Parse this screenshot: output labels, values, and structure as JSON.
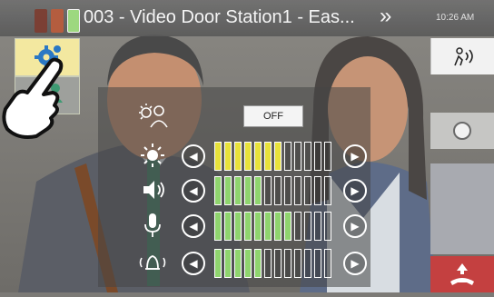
{
  "header": {
    "title": "003 - Video Door Station1 - Eas...",
    "time": "10:26 AM",
    "next_icon": "double-chevron-right-icon",
    "signal_colors": [
      "#7a3a2e",
      "#b85a3a",
      "#9fe07f"
    ]
  },
  "left_buttons": [
    {
      "icon": "gear-icon",
      "active": true
    },
    {
      "icon": "person-adjust-icon",
      "active": false
    }
  ],
  "right_buttons": [
    {
      "icon": "talk-icon"
    },
    {
      "icon": "record-icon"
    },
    {
      "icon": "end-call-icon"
    }
  ],
  "adjust_panel": {
    "camera_toggle": {
      "icon": "person-light-icon",
      "label": "OFF"
    },
    "rows": [
      {
        "name": "brightness",
        "icon": "brightness-icon",
        "level": 0.55,
        "color": "#e8e23a"
      },
      {
        "name": "speaker-volume",
        "icon": "speaker-icon",
        "level": 0.45,
        "color": "#8fd46e"
      },
      {
        "name": "microphone-volume",
        "icon": "microphone-icon",
        "level": 0.7,
        "color": "#8fd46e"
      },
      {
        "name": "ringtone-volume",
        "icon": "bell-icon",
        "level": 0.45,
        "color": "#8fd46e"
      }
    ]
  }
}
